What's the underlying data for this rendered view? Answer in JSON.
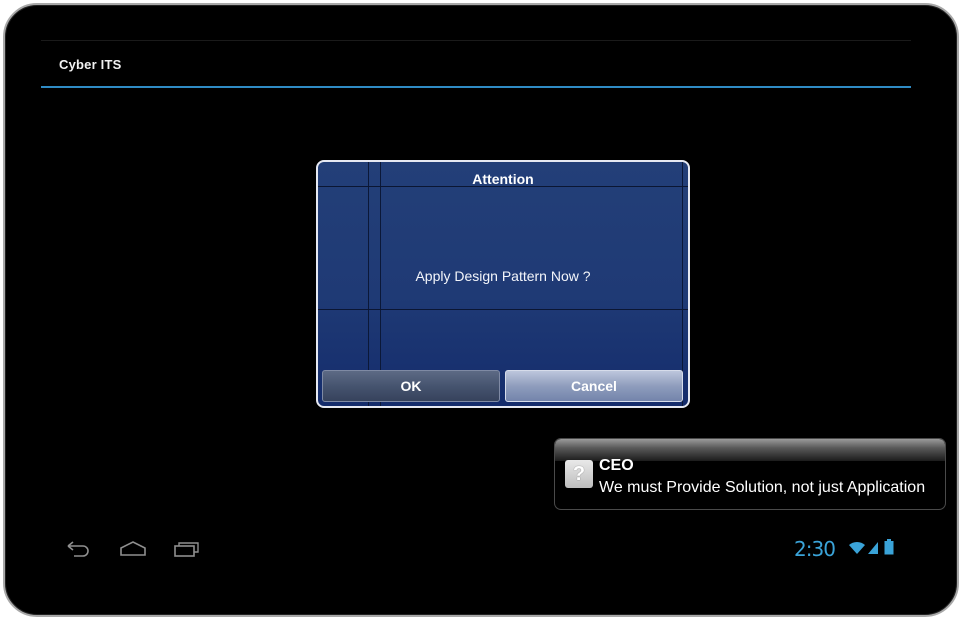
{
  "app": {
    "title": "Cyber ITS"
  },
  "dialog": {
    "title": "Attention",
    "message": "Apply Design Pattern Now ?",
    "ok_label": "OK",
    "cancel_label": "Cancel"
  },
  "notification": {
    "title": "CEO",
    "body": "We must Provide Solution, not just Application",
    "icon": "question-mark-icon"
  },
  "nav": {
    "icons": [
      "back-icon",
      "home-icon",
      "recent-apps-icon"
    ]
  },
  "status": {
    "time": "2:30",
    "icons": [
      "wifi-icon",
      "signal-icon",
      "battery-icon"
    ],
    "accent_color": "#3aa3d8"
  },
  "colors": {
    "titlebar_line": "#2f8bc4",
    "dialog_bg": "#1f3a75"
  }
}
